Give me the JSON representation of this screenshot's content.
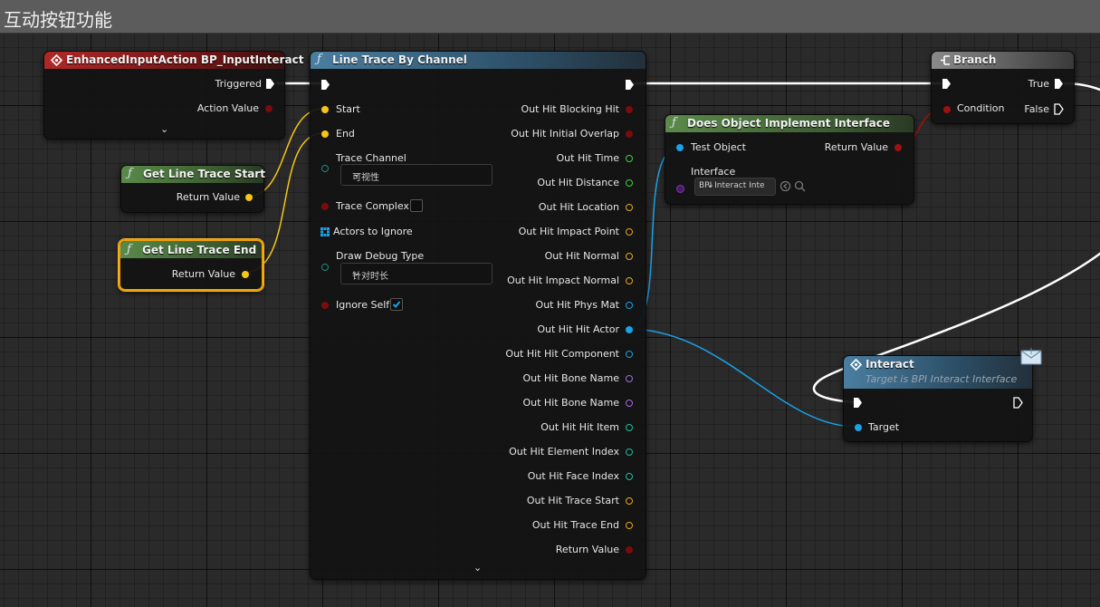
{
  "comment_title": "互动按钮功能",
  "nodes": {
    "input_event": {
      "title": "EnhancedInputAction BP_InputInteract",
      "pins": {
        "triggered": "Triggered",
        "action_value": "Action Value"
      }
    },
    "get_start": {
      "title": "Get Line Trace Start",
      "return_value": "Return Value"
    },
    "get_end": {
      "title": "Get Line Trace End",
      "return_value": "Return Value"
    },
    "line_trace": {
      "title": "Line Trace By Channel",
      "inputs": {
        "start": "Start",
        "end": "End",
        "trace_channel": "Trace Channel",
        "trace_channel_value": "可视性",
        "trace_complex": "Trace Complex",
        "actors_to_ignore": "Actors to Ignore",
        "draw_debug_type": "Draw Debug Type",
        "draw_debug_value": "针对时长",
        "ignore_self": "Ignore Self"
      },
      "outputs": [
        "Out Hit Blocking Hit",
        "Out Hit Initial Overlap",
        "Out Hit Time",
        "Out Hit Distance",
        "Out Hit Location",
        "Out Hit Impact Point",
        "Out Hit Normal",
        "Out Hit Impact Normal",
        "Out Hit Phys Mat",
        "Out Hit Hit Actor",
        "Out Hit Hit Component",
        "Out Hit Bone Name",
        "Out Hit Bone Name",
        "Out Hit Hit Item",
        "Out Hit Element Index",
        "Out Hit Face Index",
        "Out Hit Trace Start",
        "Out Hit Trace End",
        "Return Value"
      ]
    },
    "does_implement": {
      "title": "Does Object Implement Interface",
      "test_object": "Test Object",
      "return_value": "Return Value",
      "interface": "Interface",
      "interface_value": "BPI Interact Inte"
    },
    "branch": {
      "title": "Branch",
      "condition": "Condition",
      "true_label": "True",
      "false_label": "False"
    },
    "interact": {
      "title": "Interact",
      "subtitle": "Target is BPI Interact Interface",
      "target": "Target"
    }
  },
  "colors": {
    "event_header": "#8a1e1e",
    "function_header": "#3a6480",
    "pure_header": "#4a6a3a",
    "branch_header": "#6a6a6a",
    "exec_wire": "#ffffff",
    "vector_pin": "#f5c518",
    "object_pin": "#1aa1e6",
    "bool_pin": "#8c0c0c",
    "float_pin": "#3fcf3f",
    "struct_pin": "#e8a81c",
    "name_pin": "#a06ee0",
    "int_pin": "#1fbfa0",
    "interface_pin": "#6a2a9a",
    "selection": "#f0a000"
  }
}
